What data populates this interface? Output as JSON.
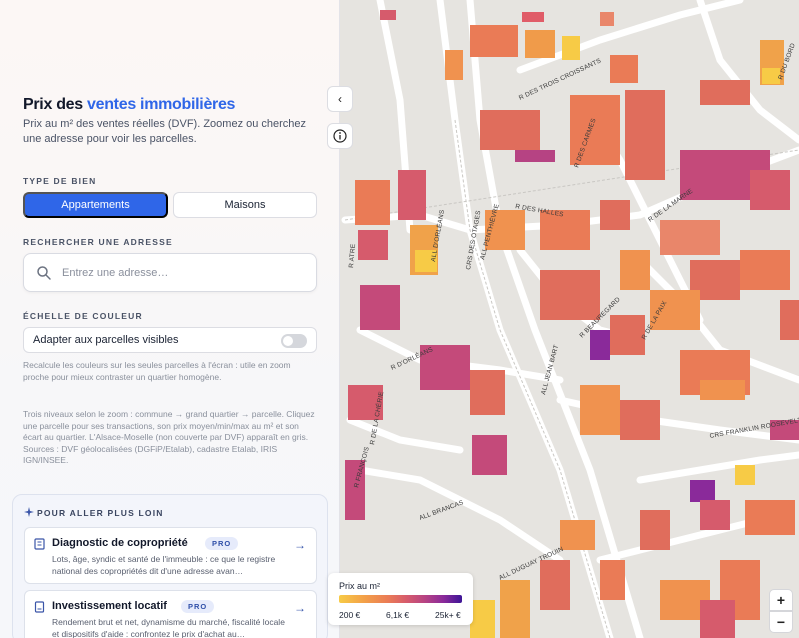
{
  "sidebar": {
    "title_prefix": "Prix des",
    "title_accent": "ventes immobilières",
    "subtitle": "Prix au m² des ventes réelles (DVF). Zoomez ou cherchez une adresse pour voir les parcelles.",
    "type_label": "TYPE DE BIEN",
    "type_options": [
      "Appartements",
      "Maisons"
    ],
    "type_selected": "Appartements",
    "search_label": "RECHERCHER UNE ADRESSE",
    "search_placeholder": "Entrez une adresse…",
    "scale_label": "ÉCHELLE DE COULEUR",
    "adapt_label": "Adapter aux parcelles visibles",
    "adapt_enabled": false,
    "adapt_hint": "Recalcule les couleurs sur les seules parcelles à l'écran : utile en zoom proche pour mieux contraster un quartier homogène.",
    "info_text": "Trois niveaux selon le zoom : commune → grand quartier → parcelle. Cliquez une parcelle pour ses transactions, son prix moyen/min/max au m² et son écart au quartier. L'Alsace-Moselle (non couverte par DVF) apparaît en gris. Sources : DVF géolocalisées (DGFiP/Etalab), cadastre Etalab, IRIS IGN/INSEE.",
    "further_label": "POUR ALLER PLUS LOIN",
    "cards": [
      {
        "title": "Diagnostic de copropriété",
        "badge": "PRO",
        "desc": "Lots, âge, syndic et santé de l'immeuble : ce que le registre national des copropriétés dit d'une adresse avan…"
      },
      {
        "title": "Investissement locatif",
        "badge": "PRO",
        "desc": "Rendement brut et net, dynamisme du marché, fiscalité locale et dispositifs d'aide : confrontez le prix d'achat au…"
      }
    ]
  },
  "map": {
    "legend_title": "Prix au m²",
    "legend_ticks": [
      "200 €",
      "6,1k €",
      "25k+ €"
    ],
    "zoom_in": "+",
    "zoom_out": "−",
    "streets": [
      "R DES TROIS CROISSANTS",
      "R DES CARMES",
      "R DES HALLES",
      "R DE LA MARNE",
      "R DU BORD",
      "ALL D'ORLÉANS",
      "CRS DES OTAGES",
      "ALL PENTHIÈVRE",
      "R ATRE",
      "R BEAUREGARD",
      "R DE LA PAIX",
      "R D'ORLÉANS",
      "ALL JEAN BART",
      "CRS FRANKLIN ROOSEVELT",
      "R DE LA CHÉRIE",
      "R FRANÇOIS",
      "ALL BRANCAS",
      "ALL DUGUAY TROUIN"
    ],
    "colors": {
      "low": "#f7cb46",
      "mid": "#ea7b56",
      "high": "#b64383",
      "top": "#3d1596"
    }
  }
}
